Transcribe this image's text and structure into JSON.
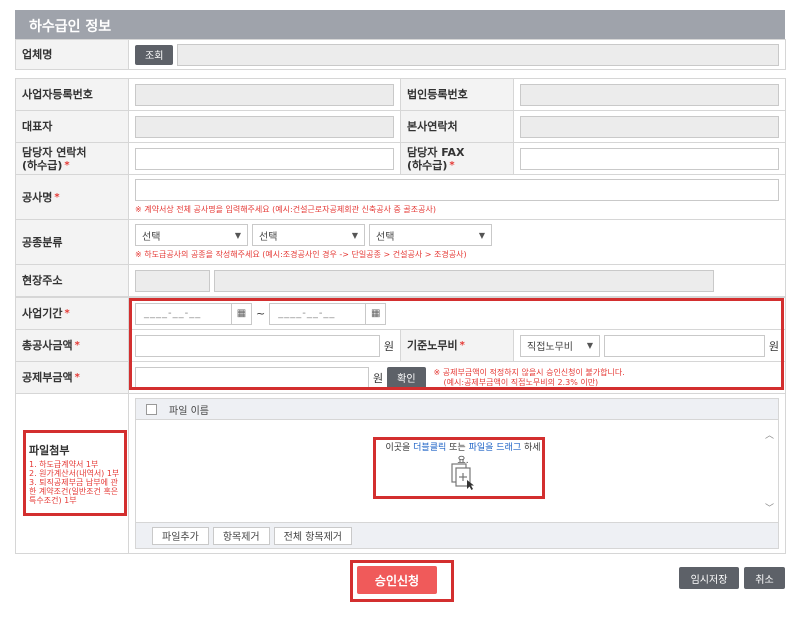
{
  "section_title": "하수급인 정보",
  "company": {
    "label": "업체명",
    "lookup_button": "조회",
    "value": ""
  },
  "info": {
    "biz_reg_no": "사업자등록번호",
    "corp_reg_no": "법인등록번호",
    "ceo": "대표자",
    "hq_contact": "본사연락처",
    "manager_contact_line1": "담당자 연락처",
    "manager_contact_line2": "(하수급)",
    "manager_fax_line1": "담당자 FAX",
    "manager_fax_line2": "(하수급)",
    "project_name": "공사명",
    "project_name_note": "※ 계약서상 전체 공사명을 입력해주세요 (예시:건설근로자공제회관 신축공사 중 골조공사)",
    "work_category": "공종분류",
    "select_placeholder": "선택",
    "work_category_note": "※ 하도급공사의 공종을 작성해주세요 (예시:조경공사인 경우 -> 단일공종 > 건설공사 > 조경공사)",
    "site_address": "현장주소"
  },
  "period": {
    "label": "사업기간",
    "date_placeholder": "____-__-__",
    "tilde": "~"
  },
  "amounts": {
    "total_label": "총공사금액",
    "won": "원",
    "labor_cost_label": "기준노무비",
    "labor_type": "직접노무비",
    "deduction_label": "공제부금액",
    "confirm_button": "확인",
    "deduction_note_line1": "※ 공제부금액이 적정하지 않을시 승인신청이 불가합니다.",
    "deduction_note_line2": "(예시:공제부금액이 직접노무비의 2.3% 이만)"
  },
  "attachment": {
    "label": "파일첨부",
    "requirements": [
      "1. 하도급계약서 1부",
      "2. 원가계산서(내역서) 1부",
      "3. 퇴직공제부금 납부에 관한 계약조건(일반조건 혹은 특수조건) 1부"
    ],
    "column_header": "파일 이름",
    "drop_text_prefix": "이곳을 ",
    "drop_text_link1": "더블클릭",
    "drop_text_mid": " 또는 ",
    "drop_text_link2": "파일을 드래그",
    "drop_text_suffix": " 하세요.",
    "add_file": "파일추가",
    "remove_item": "항목제거",
    "remove_all": "전체 항목제거"
  },
  "actions": {
    "approve": "승인신청",
    "temp_save": "임시저장",
    "cancel": "취소"
  },
  "colors": {
    "title_bar": "#9fa3ab",
    "highlight_outline": "#d32f2f",
    "approve_button": "#f05a5a",
    "note_text": "#e53935",
    "link": "#1e63c6"
  }
}
